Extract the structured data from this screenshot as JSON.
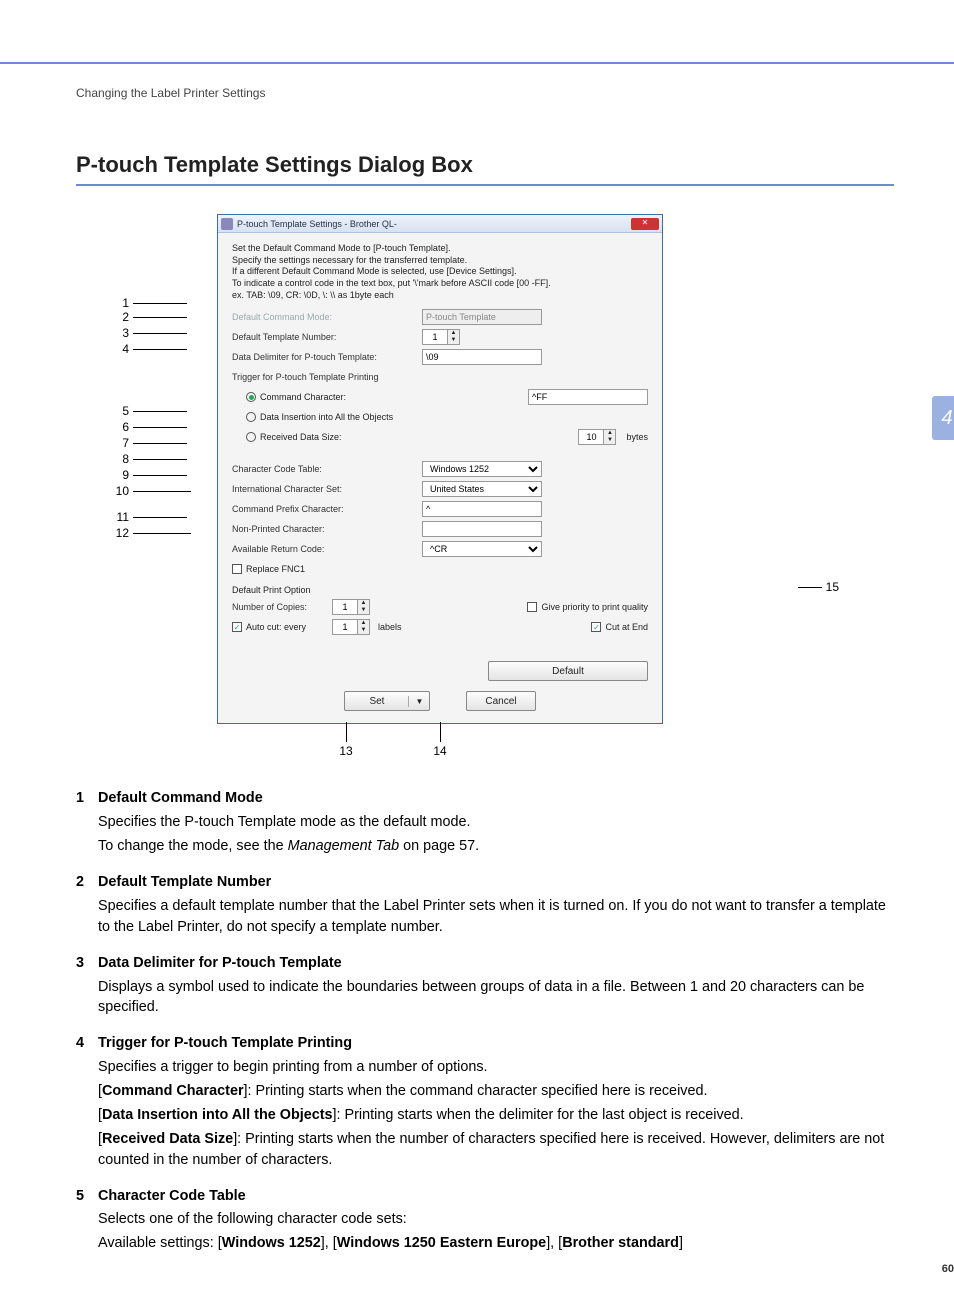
{
  "breadcrumb": "Changing the Label Printer Settings",
  "page_title": "P-touch Template Settings Dialog Box",
  "side_tab": "4",
  "page_number": "60",
  "callout_labels": [
    "1",
    "2",
    "3",
    "4",
    "5",
    "6",
    "7",
    "8",
    "9",
    "10",
    "11",
    "12",
    "13",
    "14",
    "15"
  ],
  "dialog": {
    "title": "P-touch Template Settings - Brother QL-",
    "intro_lines": [
      "Set the Default Command Mode to [P-touch Template].",
      "Specify the settings necessary for the transferred template.",
      "If a different Default Command Mode is selected, use [Device Settings].",
      "To indicate a control code in the text box, put '\\'mark before ASCII code [00 -FF].",
      "  ex. TAB: \\09,  CR: \\0D,  \\: \\\\  as 1byte each"
    ],
    "fields": {
      "default_command_mode": {
        "label": "Default Command Mode:",
        "value": "P-touch Template"
      },
      "default_template_number": {
        "label": "Default Template Number:",
        "value": "1"
      },
      "data_delimiter": {
        "label": "Data Delimiter for P-touch Template:",
        "value": "\\09"
      },
      "trigger_group": {
        "label": "Trigger for P-touch Template Printing"
      },
      "command_character": {
        "label": "Command Character:",
        "value": "^FF",
        "checked": true
      },
      "data_insertion": {
        "label": "Data Insertion into All the Objects",
        "checked": false
      },
      "received_data_size": {
        "label": "Received Data Size:",
        "value": "10",
        "unit": "bytes",
        "checked": false
      },
      "char_code_table": {
        "label": "Character Code Table:",
        "value": "Windows 1252"
      },
      "intl_char_set": {
        "label": "International Character Set:",
        "value": "United States"
      },
      "cmd_prefix": {
        "label": "Command Prefix Character:",
        "value": "^"
      },
      "non_printed": {
        "label": "Non-Printed Character:",
        "value": ""
      },
      "return_code": {
        "label": "Available Return Code:",
        "value": "^CR"
      },
      "replace_fnc1": {
        "label": "Replace FNC1",
        "checked": false
      },
      "default_print_option": "Default Print Option",
      "num_copies": {
        "label": "Number of Copies:",
        "value": "1"
      },
      "priority_quality": {
        "label": "Give priority to print quality",
        "checked": false
      },
      "auto_cut": {
        "label": "Auto cut:   every",
        "value": "1",
        "unit": "labels",
        "checked": true
      },
      "cut_at_end": {
        "label": "Cut at End",
        "checked": true
      }
    },
    "buttons": {
      "default": "Default",
      "set": "Set",
      "cancel": "Cancel"
    }
  },
  "definitions": [
    {
      "num": "1",
      "head": "Default Command Mode",
      "paras": [
        "Specifies the P-touch Template mode as the default mode.",
        "To change the mode, see the <i>Management Tab</i> on page 57."
      ]
    },
    {
      "num": "2",
      "head": "Default Template Number",
      "paras": [
        "Specifies a default template number that the Label Printer sets when it is turned on. If you do not want to transfer a template to the Label Printer, do not specify a template number."
      ]
    },
    {
      "num": "3",
      "head": "Data Delimiter for P-touch Template",
      "paras": [
        "Displays a symbol used to indicate the boundaries between groups of data in a file. Between 1 and 20 characters can be specified."
      ]
    },
    {
      "num": "4",
      "head": "Trigger for P-touch Template Printing",
      "paras": [
        "Specifies a trigger to begin printing from a number of options.",
        "[<b>Command Character</b>]: Printing starts when the command character specified here is received.",
        "[<b>Data Insertion into All the Objects</b>]: Printing starts when the delimiter for the last object is received.",
        "[<b>Received Data Size</b>]: Printing starts when the number of characters specified here is received. However, delimiters are not counted in the number of characters."
      ]
    },
    {
      "num": "5",
      "head": "Character Code Table",
      "paras": [
        "Selects one of the following character code sets:",
        "Available settings: [<b>Windows 1252</b>], [<b>Windows 1250 Eastern Europe</b>], [<b>Brother standard</b>]"
      ]
    }
  ]
}
